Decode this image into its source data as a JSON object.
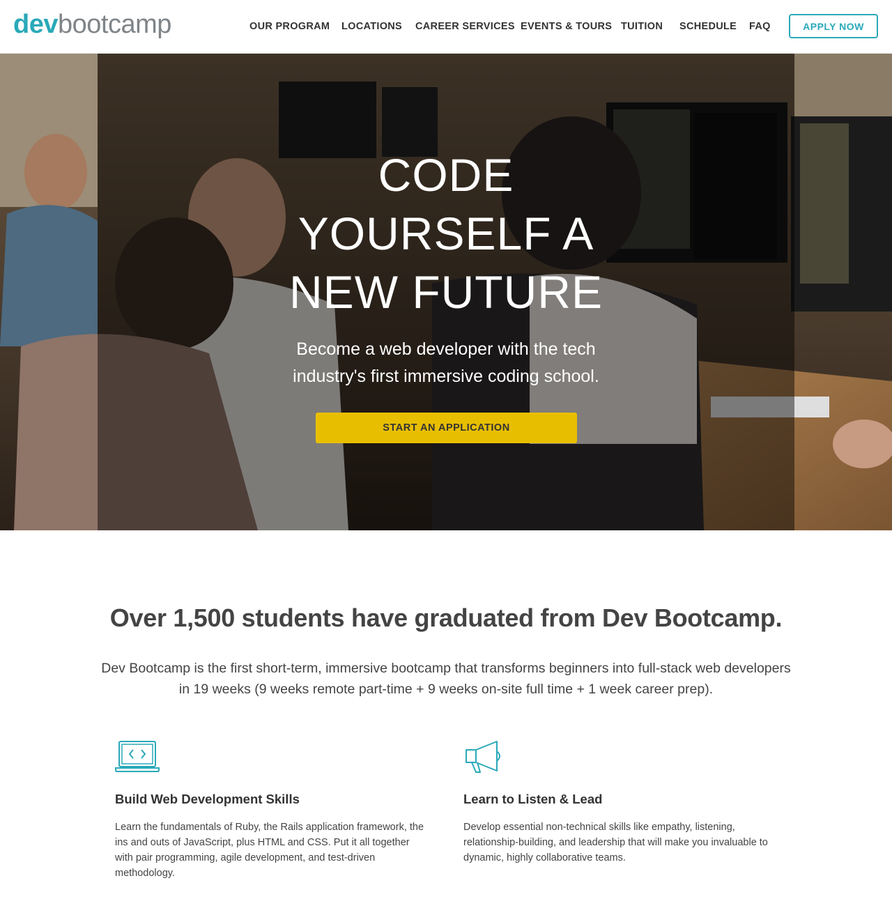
{
  "header": {
    "logo": {
      "part1": "dev",
      "part2": "bootcamp"
    },
    "nav": [
      {
        "label": "OUR PROGRAM"
      },
      {
        "label": "LOCATIONS"
      },
      {
        "label": "CAREER SERVICES"
      },
      {
        "label": "EVENTS & TOURS"
      },
      {
        "label": "TUITION"
      },
      {
        "label": "SCHEDULE"
      },
      {
        "label": "FAQ"
      }
    ],
    "apply_label": "APPLY NOW"
  },
  "hero": {
    "title_lines": [
      "CODE",
      "YOURSELF A",
      "NEW FUTURE"
    ],
    "subtitle_lines": [
      "Become a web developer with the tech",
      "industry's first immersive coding school."
    ],
    "cta_label": "START AN APPLICATION"
  },
  "main": {
    "headline": "Over 1,500 students have graduated from Dev Bootcamp.",
    "intro": "Dev Bootcamp is the first short-term, immersive bootcamp that transforms beginners into full-stack web developers in 19 weeks (9 weeks remote part-time + 9 weeks on-site full time + 1 week career prep).",
    "features": [
      {
        "icon": "laptop-code-icon",
        "title": "Build Web Development Skills",
        "text": "Learn the fundamentals of Ruby, the Rails application framework, the ins and outs of JavaScript, plus HTML and CSS. Put it all together with pair programming, agile development, and test-driven methodology."
      },
      {
        "icon": "megaphone-icon",
        "title": "Learn to Listen & Lead",
        "text": "Develop essential non-technical skills like empathy, listening, relationship-building, and leadership that will make you invaluable to dynamic, highly collaborative teams."
      }
    ]
  },
  "colors": {
    "brand_teal": "#2aa9b9",
    "logo_gray": "#7f8488",
    "cta_yellow": "#e8bf00",
    "text_dark": "#444444"
  }
}
